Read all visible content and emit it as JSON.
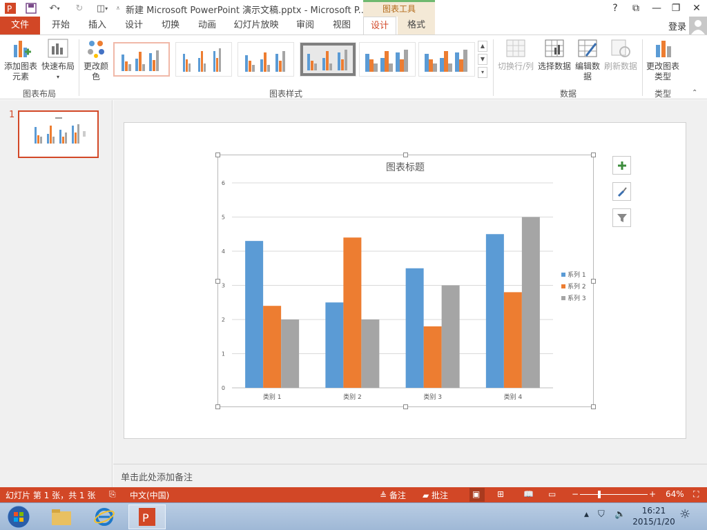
{
  "window": {
    "title": "新建 Microsoft PowerPoint 演示文稿.pptx - Microsoft P...",
    "context_tools": "图表工具",
    "help": "?",
    "restore_glyph": "⧉",
    "minimize_glyph": "🗕",
    "close_glyph": "✕"
  },
  "tabs": {
    "file": "文件",
    "items": [
      "开始",
      "插入",
      "设计",
      "切换",
      "动画",
      "幻灯片放映",
      "审阅",
      "视图",
      "设计",
      "格式"
    ],
    "active_index": 8,
    "login": "登录"
  },
  "ribbon": {
    "add_chart_element": "添加图表元素",
    "quick_layout": "快速布局",
    "group_layout": "图表布局",
    "change_colors": "更改颜色",
    "group_styles": "图表样式",
    "switch_row_col": "切换行/列",
    "select_data": "选择数据",
    "edit_data": "编辑数据",
    "refresh_data": "刷新数据",
    "group_data": "数据",
    "change_chart_type": "更改图表类型",
    "group_type": "类型"
  },
  "slides_pane": {
    "slide_number": "1"
  },
  "notes": {
    "placeholder": "单击此处添加备注"
  },
  "status": {
    "slide_info": "幻灯片 第 1 张，共 1 张",
    "language": "中文(中国)",
    "notes_btn": "备注",
    "comments_btn": "批注",
    "zoom": "64%"
  },
  "taskbar": {
    "time": "16:21",
    "date": "2015/1/20"
  },
  "colors": {
    "accent": "#d24726",
    "series1": "#5b9bd5",
    "series2": "#ed7d31",
    "series3": "#a5a5a5"
  },
  "chart_data": {
    "type": "bar",
    "title": "图表标题",
    "categories": [
      "类别 1",
      "类别 2",
      "类别 3",
      "类别 4"
    ],
    "series": [
      {
        "name": "系列 1",
        "values": [
          4.3,
          2.5,
          3.5,
          4.5
        ]
      },
      {
        "name": "系列 2",
        "values": [
          2.4,
          4.4,
          1.8,
          2.8
        ]
      },
      {
        "name": "系列 3",
        "values": [
          2,
          2,
          3,
          5
        ]
      }
    ],
    "ylim": [
      0,
      6
    ],
    "yticks": [
      "0",
      "1",
      "2",
      "3",
      "4",
      "5",
      "6"
    ],
    "grid": true,
    "legend": "right"
  }
}
